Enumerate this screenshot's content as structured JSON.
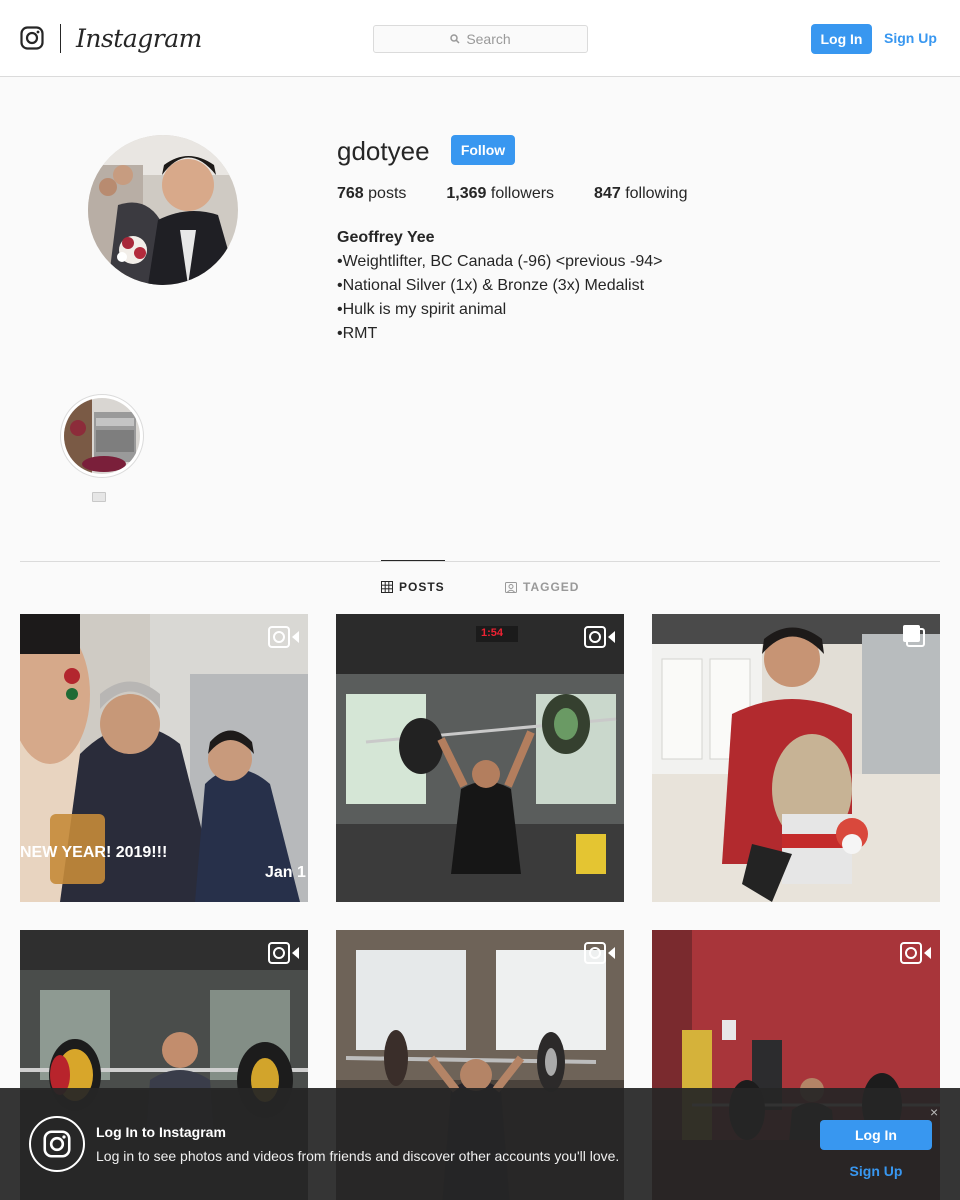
{
  "nav": {
    "wordmark": "Instagram",
    "search_placeholder": "Search",
    "login_label": "Log In",
    "signup_label": "Sign Up"
  },
  "profile": {
    "username": "gdotyee",
    "follow_label": "Follow",
    "stats": {
      "posts_count": "768",
      "posts_label": "posts",
      "followers_count": "1,369",
      "followers_label": "followers",
      "following_count": "847",
      "following_label": "following"
    },
    "bio": {
      "name": "Geoffrey Yee",
      "lines": [
        "•Weightlifter, BC Canada (-96) <previous -94>",
        "•National Silver (1x) & Bronze (3x) Medalist",
        "•Hulk is my spirit animal",
        "•RMT"
      ]
    }
  },
  "tabs": {
    "posts": "POSTS",
    "tagged": "TAGGED"
  },
  "posts": [
    {
      "type": "video",
      "overlay_text_left": "NEW YEAR! 2019!!!",
      "overlay_text_right": "Jan 1"
    },
    {
      "type": "video",
      "overlay_text_left": "1:54",
      "overlay_text_right": ""
    },
    {
      "type": "carousel",
      "overlay_text_left": "",
      "overlay_text_right": ""
    },
    {
      "type": "video",
      "overlay_text_left": "",
      "overlay_text_right": ""
    },
    {
      "type": "video",
      "overlay_text_left": "",
      "overlay_text_right": ""
    },
    {
      "type": "video",
      "overlay_text_left": "",
      "overlay_text_right": ""
    }
  ],
  "banner": {
    "title": "Log In to Instagram",
    "text": "Log in to see photos and videos from friends and discover other accounts you'll love.",
    "close": "×",
    "login_label": "Log In",
    "signup_label": "Sign Up"
  },
  "colors": {
    "accent": "#3897f0",
    "text": "#262626",
    "muted": "#999999",
    "border": "#dbdbdb",
    "page_bg": "#fafafa"
  },
  "icons": [
    "instagram-glyph-icon",
    "search-icon",
    "grid-icon",
    "tagged-icon",
    "video-icon",
    "carousel-icon",
    "close-icon"
  ]
}
